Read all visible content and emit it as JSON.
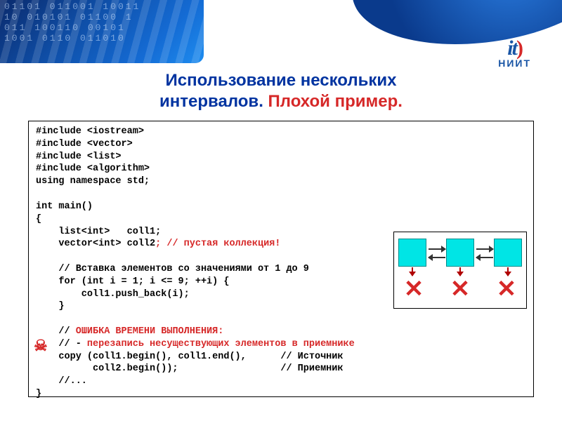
{
  "banner": {
    "bits": "01101 011001 10011\n10 010101 01100 1\n011 100110 00101\n1001 0110 011010"
  },
  "logo": {
    "top_left": "it",
    "top_right": ")",
    "sub": "НИИТ"
  },
  "heading": {
    "line1": "Использование нескольких",
    "line2a": "интервалов.",
    "line2b": "Плохой пример."
  },
  "code": {
    "l01": "#include <iostream>",
    "l02": "#include <vector>",
    "l03": "#include <list>",
    "l04": "#include <algorithm>",
    "l05": "using namespace std;",
    "l06": "",
    "l07": "int main()",
    "l08": "{",
    "l09": "    list<int>   coll1;",
    "l10a": "    vector<int> coll2",
    "l10b": "; // пустая коллекция!",
    "l11": "",
    "l12": "    // Вставка элементов со значениями от 1 до 9",
    "l13": "    for (int i = 1; i <= 9; ++i) {",
    "l14": "        coll1.push_back(i);",
    "l15": "    }",
    "l16": "",
    "l17a": "    // ",
    "l17b": "ОШИБКА ВРЕМЕНИ ВЫПОЛНЕНИЯ:",
    "l18a": "    // - ",
    "l18b": "перезапись несуществующих элементов в приемнике",
    "l19a": "    copy (coll1.begin(), coll1.end(),      ",
    "l19b": "// Источник",
    "l20a": "          coll2.begin());                  ",
    "l20b": "// Приемник",
    "l21": "    //...",
    "l22": "}"
  },
  "skull": "☠",
  "diagram": {
    "x": "✕"
  }
}
